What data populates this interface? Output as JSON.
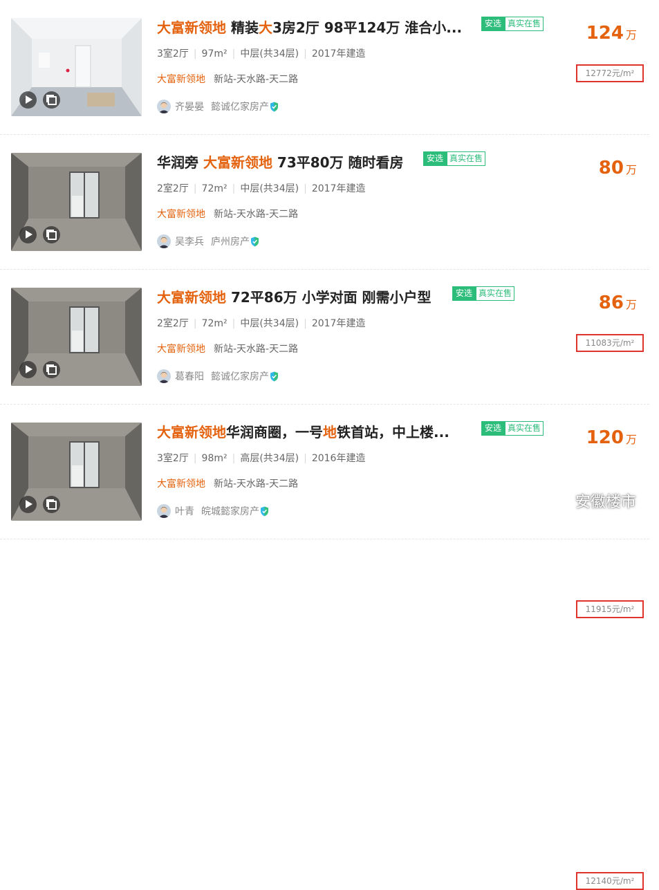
{
  "listings": [
    {
      "title_parts": [
        {
          "t": "大富新领地",
          "hl": true
        },
        {
          "t": " 精装",
          "hl": false
        },
        {
          "t": "大",
          "hl": true
        },
        {
          "t": "3房2厅 98平124万 淮合小...",
          "hl": false
        }
      ],
      "tag_primary": "安选",
      "tag_secondary": "真实在售",
      "layout": "3室2厅",
      "area": "97m²",
      "floor": "中层(共34层)",
      "year": "2017年建造",
      "community": "大富新领地",
      "address": "新站-天水路-天二路",
      "agent_name": "齐晏晏",
      "agent_company": "懿诚亿家房产",
      "price": "124",
      "price_unit": "万",
      "unit_price": "12772元/m²",
      "photo_kind": "finished"
    },
    {
      "title_parts": [
        {
          "t": "华润旁 ",
          "hl": false
        },
        {
          "t": "大富新领地",
          "hl": true
        },
        {
          "t": " 73平80万 随时看房",
          "hl": false
        }
      ],
      "tag_primary": "安选",
      "tag_secondary": "真实在售",
      "layout": "2室2厅",
      "area": "72m²",
      "floor": "中层(共34层)",
      "year": "2017年建造",
      "community": "大富新领地",
      "address": "新站-天水路-天二路",
      "agent_name": "吴李兵",
      "agent_company": "庐州房产",
      "price": "80",
      "price_unit": "万",
      "unit_price": "11083元/m²",
      "photo_kind": "concrete"
    },
    {
      "title_parts": [
        {
          "t": "大富新领地",
          "hl": true
        },
        {
          "t": " 72平86万 小学对面 刚需小户型",
          "hl": false
        }
      ],
      "tag_primary": "安选",
      "tag_secondary": "真实在售",
      "layout": "2室2厅",
      "area": "72m²",
      "floor": "中层(共34层)",
      "year": "2017年建造",
      "community": "大富新领地",
      "address": "新站-天水路-天二路",
      "agent_name": "葛春阳",
      "agent_company": "懿诚亿家房产",
      "price": "86",
      "price_unit": "万",
      "unit_price": "11915元/m²",
      "photo_kind": "concrete"
    },
    {
      "title_parts": [
        {
          "t": "大富新领地",
          "hl": true
        },
        {
          "t": "华润商圈，一号",
          "hl": false
        },
        {
          "t": "地",
          "hl": true
        },
        {
          "t": "铁首站，中上楼...",
          "hl": false
        }
      ],
      "tag_primary": "安选",
      "tag_secondary": "真实在售",
      "layout": "3室2厅",
      "area": "98m²",
      "floor": "高层(共34层)",
      "year": "2016年建造",
      "community": "大富新领地",
      "address": "新站-天水路-天二路",
      "agent_name": "叶青",
      "agent_company": "皖城懿家房产",
      "price": "120",
      "price_unit": "万",
      "unit_price": "12140元/m²",
      "photo_kind": "concrete"
    }
  ],
  "watermark": {
    "text": "安徽楼市",
    "icon": "wechat-icon"
  },
  "colors": {
    "accent": "#e4620d",
    "tag": "#2dbd7b",
    "highlight_box": "#e0332e"
  }
}
